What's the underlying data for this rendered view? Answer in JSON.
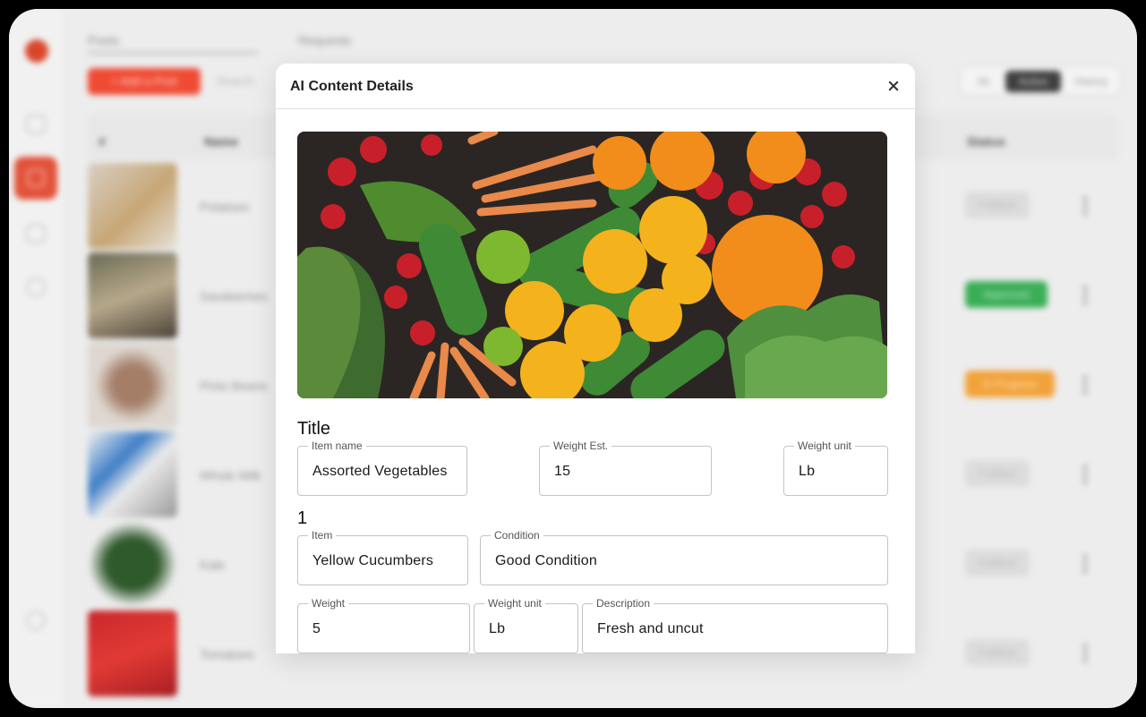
{
  "background": {
    "tabs": [
      "Posts",
      "Requests"
    ],
    "add_button": "+ Add a Post",
    "search_placeholder": "Search",
    "filter_options": [
      "All",
      "Active",
      "History"
    ],
    "columns": [
      "#",
      "Name",
      "Status"
    ],
    "rows": [
      {
        "name": "Potatoes",
        "status": "Fulfilled"
      },
      {
        "name": "Sandwiches",
        "status": "Approved"
      },
      {
        "name": "Pinto Beans",
        "status": "In Progress"
      },
      {
        "name": "Whole Milk",
        "status": "Fulfilled"
      },
      {
        "name": "Kale",
        "status": "Fulfilled"
      },
      {
        "name": "Tomatoes",
        "status": "Fulfilled"
      }
    ]
  },
  "modal": {
    "title": "AI Content Details",
    "image_alt": "Crate of assorted vegetables and fruits",
    "section_title": "Title",
    "item_name": {
      "label": "Item name",
      "value": "Assorted Vegetables"
    },
    "weight_est": {
      "label": "Weight Est.",
      "value": "15"
    },
    "weight_unit": {
      "label": "Weight unit",
      "value": "Lb"
    },
    "item_section": "1",
    "item": {
      "label": "Item",
      "value": "Yellow Cucumbers"
    },
    "condition": {
      "label": "Condition",
      "value": "Good Condition"
    },
    "item_weight": {
      "label": "Weight",
      "value": "5"
    },
    "item_weight_unit": {
      "label": "Weight unit",
      "value": "Lb"
    },
    "description": {
      "label": "Description",
      "value": "Fresh and uncut"
    }
  },
  "colors": {
    "accent": "#ef4b33",
    "approved": "#3aae57",
    "in_progress": "#f2a23a"
  }
}
